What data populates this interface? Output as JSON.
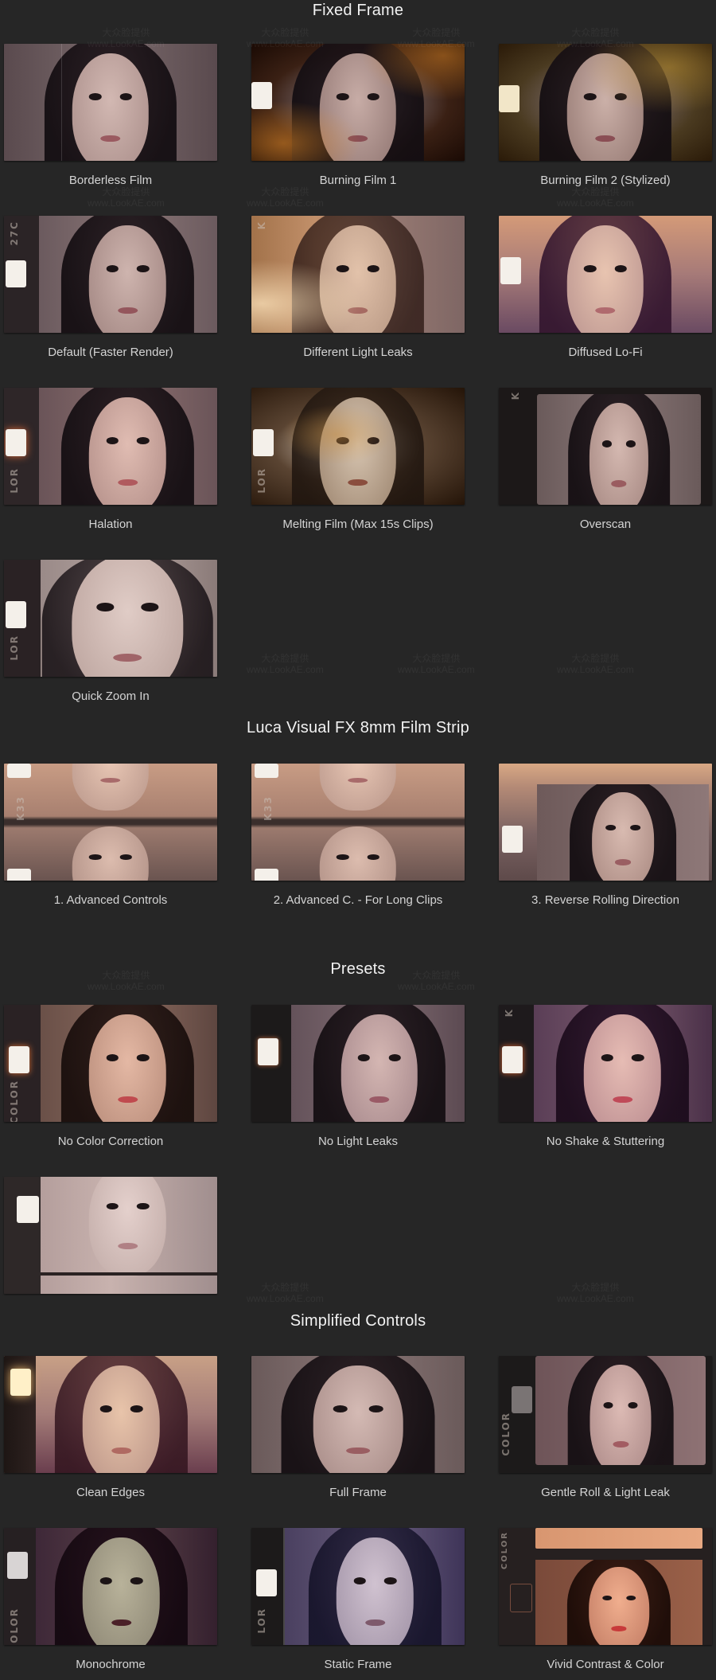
{
  "sections": [
    {
      "title": "Fixed Frame",
      "items": [
        "Borderless Film",
        "Burning Film 1",
        "Burning Film 2 (Stylized)",
        "Default (Faster Render)",
        "Different Light Leaks",
        "Diffused Lo-Fi",
        "Halation",
        "Melting Film (Max 15s Clips)",
        "Overscan",
        "Quick Zoom In"
      ]
    },
    {
      "title": "Luca Visual FX 8mm Film Strip",
      "items": [
        "1. Advanced Controls",
        "2. Advanced C. - For Long Clips",
        "3. Reverse Rolling Direction"
      ]
    },
    {
      "title": "Presets",
      "items": [
        "No Color Correction",
        "No Light Leaks",
        "No Shake & Stuttering",
        ""
      ]
    },
    {
      "title": "Simplified Controls",
      "items": [
        "Clean Edges",
        "Full Frame",
        "Gentle Roll & Light Leak",
        "Monochrome",
        "Static Frame",
        "Vivid Contrast & Color"
      ]
    }
  ],
  "film_edge_text": [
    "27C",
    "K",
    "LOR",
    "LOR",
    "K",
    "LOR",
    "K33",
    "K33",
    "COLOR",
    "COLOR",
    "COLOR",
    "LOR",
    "COLOR"
  ],
  "watermark": [
    "大众脸提供",
    "www.LookAE.com"
  ],
  "colors": {
    "background": "#262626",
    "title_text": "#f2f2f2",
    "caption_text": "#d4d4d4"
  }
}
